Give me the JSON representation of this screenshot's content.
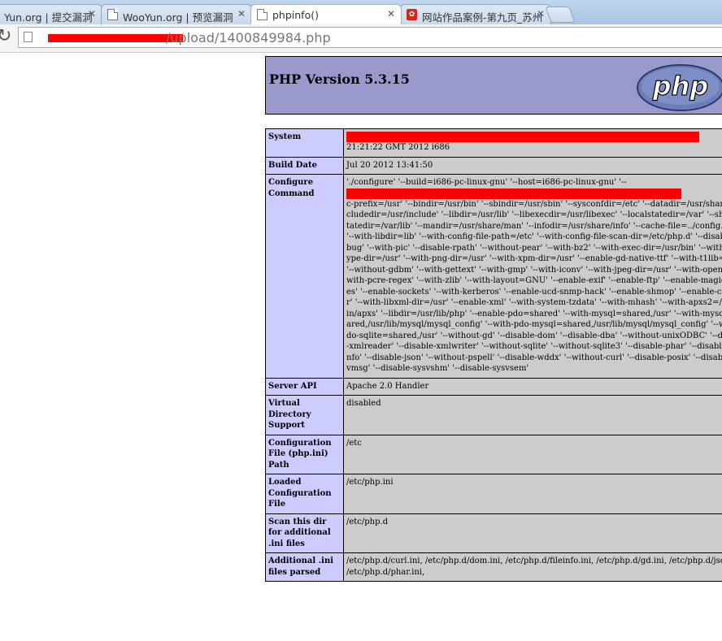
{
  "tabs": [
    {
      "label": "Yun.org | 提交漏洞",
      "icon": "page-icon",
      "active": false
    },
    {
      "label": "WooYun.org | 预览漏洞",
      "icon": "page-icon",
      "active": false
    },
    {
      "label": "phpinfo()",
      "icon": "page-icon",
      "active": true
    },
    {
      "label": "网站作品案例-第九页_苏州",
      "icon": "site-logo-icon",
      "active": false
    }
  ],
  "address_bar": {
    "url_path": "/upload/1400849984.php"
  },
  "page": {
    "php_version": "PHP Version 5.3.15",
    "logo_text": "php",
    "rows": [
      {
        "key": "System",
        "value": "21:21:22 GMT 2012 i686",
        "redacted_prefix": true
      },
      {
        "key": "Build Date",
        "value": "Jul 20 2012 13:41:50"
      },
      {
        "key": "Configure Command",
        "value_first": "'./configure' '--build=i686-pc-linux-gnu' '--host=i686-pc-linux-gnu' '--",
        "value_rest": "c-prefix=/usr' '--bindir=/usr/bin' '--sbindir=/usr/sbin' '--sysconfdir=/etc' '--datadir=/usr/share' '--includedir=/usr/include' '--libdir=/usr/lib' '--libexecdir=/usr/libexec' '--localstatedir=/var' '--sharedstatedir=/var/lib' '--mandir=/usr/share/man' '--infodir=/usr/share/info' '--cache-file=../config.cache' '--with-libdir=lib' '--with-config-file-path=/etc' '--with-config-file-scan-dir=/etc/php.d' '--disable-debug' '--with-pic' '--disable-rpath' '--without-pear' '--with-bz2' '--with-exec-dir=/usr/bin' '--with-freetype-dir=/usr' '--with-png-dir=/usr' '--with-xpm-dir=/usr' '--enable-gd-native-ttf' '--with-t1lib=/usr' '--without-gdbm' '--with-gettext' '--with-gmp' '--with-iconv' '--with-jpeg-dir=/usr' '--with-openssl' '--with-pcre-regex' '--with-zlib' '--with-layout=GNU' '--enable-exif' '--enable-ftp' '--enable-magic-quotes' '--enable-sockets' '--with-kerberos' '--enable-ucd-snmp-hack' '--enable-shmop' '--enable-calendar' '--with-libxml-dir=/usr' '--enable-xml' '--with-system-tzdata' '--with-mhash' '--with-apxs2=/usr/sbin/apxs' '--libdir=/usr/lib/php' '--enable-pdo=shared' '--with-mysql=shared,/usr' '--with-mysqli=shared,/usr/lib/mysql/mysql_config' '--with-pdo-mysql=shared,/usr/lib/mysql/mysql_config' '--with-pdo-sqlite=shared,/usr' '--without-gd' '--disable-dom' '--disable-dba' '--without-unixODBC' '--disable-xmlreader' '--disable-xmlwriter' '--without-sqlite' '--without-sqlite3' '--disable-phar' '--disable-fileinfo' '--disable-json' '--without-pspell' '--disable-wddx' '--without-curl' '--disable-posix' '--disable-sysvmsg' '--disable-sysvshm' '--disable-sysvsem'"
      },
      {
        "key": "Server API",
        "value": "Apache 2.0 Handler"
      },
      {
        "key": "Virtual Directory Support",
        "value": "disabled"
      },
      {
        "key": "Configuration File (php.ini) Path",
        "value": "/etc"
      },
      {
        "key": "Loaded Configuration File",
        "value": "/etc/php.ini"
      },
      {
        "key": "Scan this dir for additional .ini files",
        "value": "/etc/php.d"
      },
      {
        "key": "Additional .ini files parsed",
        "value": "/etc/php.d/curl.ini, /etc/php.d/dom.ini, /etc/php.d/fileinfo.ini, /etc/php.d/gd.ini, /etc/php.d/json.ini, /etc/php.d/phar.ini,"
      }
    ]
  },
  "colors": {
    "header_bg": "#9999cc",
    "key_bg": "#ccccff",
    "value_bg": "#cccccc",
    "redaction": "#ff0000"
  }
}
